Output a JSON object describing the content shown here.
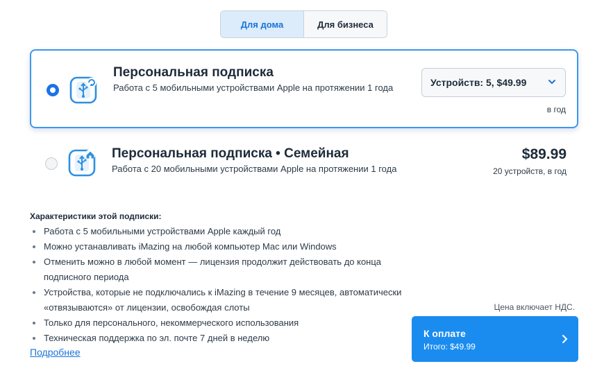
{
  "tabs": [
    {
      "label": "Для дома",
      "active": true
    },
    {
      "label": "Для бизнеса",
      "active": false
    }
  ],
  "plans": [
    {
      "title": "Персональная подписка",
      "description": "Работа с 5 мобильными устройствами Apple на протяжении 1 года",
      "selected": true,
      "select_value": "Устройств: 5, $49.99",
      "period": "в год",
      "icon": "usb-sync-icon"
    },
    {
      "title": "Персональная подписка • Семейная",
      "description": "Работа с 20 мобильными устройствами Apple на протяжении 1 года",
      "selected": false,
      "price": "$89.99",
      "price_sub": "20 устройств, в год",
      "icon": "usb-family-icon"
    }
  ],
  "features": {
    "title": "Характеристики этой подписки:",
    "items": [
      "Работа с 5 мобильными устройствами Apple каждый год",
      "Можно устанавливать iMazing на любой компьютер Mac или Windows",
      "Отменить можно в любой момент — лицензия продолжит действовать до конца подписного периода",
      "Устройства, которые не подключались к iMazing в течение 9 месяцев, автоматически «отвязываются» от лицензии, освобождая слоты",
      "Только для персонального, некоммерческого использования",
      "Техническая поддержка по эл. почте 7 дней в неделю"
    ],
    "more_link": "Подробнее"
  },
  "checkout": {
    "vat_note": "Цена включает НДС.",
    "title": "К оплате",
    "total": "Итого: $49.99"
  },
  "colors": {
    "accent": "#1a8cf0",
    "selected_border": "#3d97ea",
    "tab_active_bg": "#dcecfb"
  }
}
